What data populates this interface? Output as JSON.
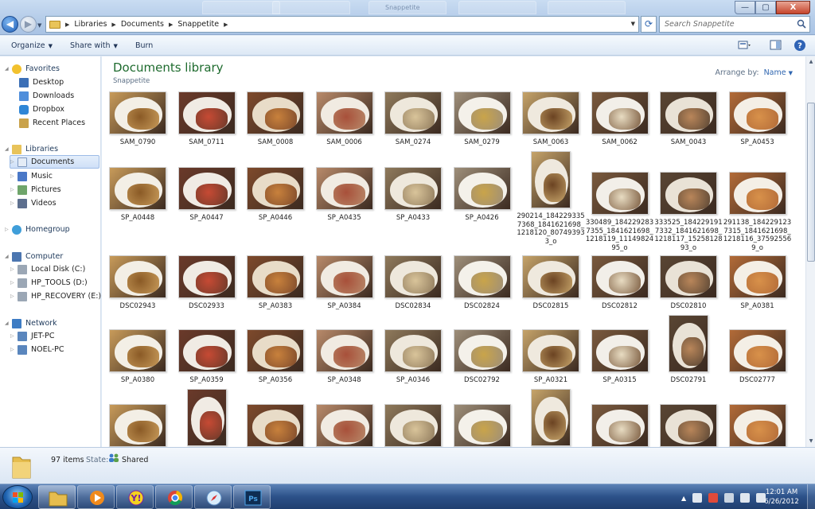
{
  "window": {
    "breadcrumbs": [
      "Libraries",
      "Documents",
      "Snappetite"
    ],
    "search_placeholder": "Search Snappetite",
    "controls": {
      "minimize": "—",
      "maximize": "▢",
      "close": "X"
    },
    "ghost_tabs": [
      "",
      "",
      "",
      "",
      "",
      "Snappetite"
    ]
  },
  "toolbar": {
    "organize": "Organize",
    "share_with": "Share with",
    "burn": "Burn"
  },
  "sidebar": {
    "favorites": {
      "label": "Favorites",
      "items": [
        "Desktop",
        "Downloads",
        "Dropbox",
        "Recent Places"
      ]
    },
    "libraries": {
      "label": "Libraries",
      "items": [
        "Documents",
        "Music",
        "Pictures",
        "Videos"
      ]
    },
    "homegroup": {
      "label": "Homegroup"
    },
    "computer": {
      "label": "Computer",
      "items": [
        "Local Disk (C:)",
        "HP_TOOLS (D:)",
        "HP_RECOVERY (E:)"
      ]
    },
    "network": {
      "label": "Network",
      "items": [
        "JET-PC",
        "NOEL-PC"
      ]
    }
  },
  "content": {
    "title": "Documents library",
    "subtitle": "Snappetite",
    "arrange_label": "Arrange by:",
    "arrange_value": "Name",
    "files": [
      "SAM_0790",
      "SAM_0711",
      "SAM_0008",
      "SAM_0006",
      "SAM_0274",
      "SAM_0279",
      "SAM_0063",
      "SAM_0062",
      "SAM_0043",
      "SP_A0453",
      "SP_A0448",
      "SP_A0447",
      "SP_A0446",
      "SP_A0435",
      "SP_A0433",
      "SP_A0426",
      "290214_184229335736​8_1841621698_1218120_807493933_o",
      "330489_184229283735​5_1841621698_1218119_1114982495_o",
      "333525_184229191733​2_1841621698_1218117_1525812893_o",
      "291138_184229123731​5_1841621698_1218116_375925569_o",
      "DSC02943",
      "DSC02933",
      "SP_A0383",
      "SP_A0384",
      "DSC02834",
      "DSC02824",
      "DSC02815",
      "DSC02812",
      "DSC02810",
      "SP_A0381",
      "SP_A0380",
      "SP_A0359",
      "SP_A0356",
      "SP_A0348",
      "SP_A0346",
      "DSC02792",
      "SP_A0321",
      "SP_A0315",
      "DSC02791",
      "DSC02777",
      "",
      "",
      "",
      "",
      "",
      "",
      "",
      "",
      "",
      ""
    ]
  },
  "details": {
    "item_count": "97 items",
    "state_label": "State:",
    "state_value": "Shared"
  },
  "taskbar": {
    "time": "12:01 AM",
    "date": "6/26/2012"
  }
}
